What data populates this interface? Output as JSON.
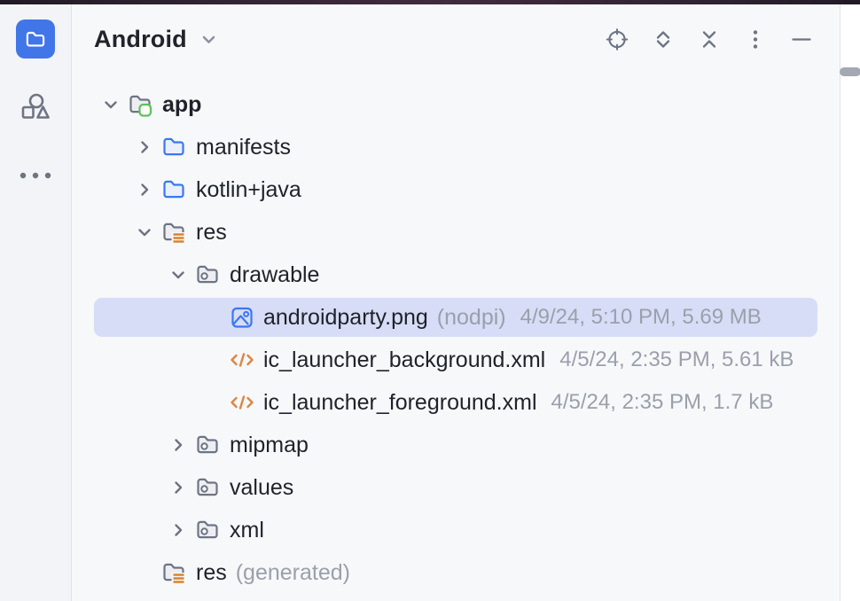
{
  "sidebar": {
    "tools": [
      {
        "name": "project",
        "selected": true
      },
      {
        "name": "resource-manager",
        "selected": false
      },
      {
        "name": "more-tool-windows",
        "selected": false
      }
    ]
  },
  "header": {
    "title": "Android",
    "actions": [
      {
        "name": "locate-file"
      },
      {
        "name": "expand-all"
      },
      {
        "name": "collapse-all"
      },
      {
        "name": "options"
      },
      {
        "name": "hide"
      }
    ]
  },
  "tree": {
    "rows": [
      {
        "label": "app",
        "icon": "module-folder",
        "chevron": "expanded",
        "depth": 0,
        "bold": true
      },
      {
        "label": "manifests",
        "icon": "blue-folder",
        "chevron": "collapsed",
        "depth": 1
      },
      {
        "label": "kotlin+java",
        "icon": "blue-folder",
        "chevron": "collapsed",
        "depth": 1
      },
      {
        "label": "res",
        "icon": "resources-folder",
        "chevron": "expanded",
        "depth": 1
      },
      {
        "label": "drawable",
        "icon": "resource-type-folder",
        "chevron": "expanded",
        "depth": 2
      },
      {
        "label": "androidparty.png",
        "suffix": "(nodpi)",
        "meta": "4/9/24, 5:10 PM, 5.69 MB",
        "icon": "image-file",
        "chevron": "none",
        "depth": 3,
        "selected": true
      },
      {
        "label": "ic_launcher_background.xml",
        "meta": "4/5/24, 2:35 PM, 5.61 kB",
        "icon": "xml-file",
        "chevron": "none",
        "depth": 3
      },
      {
        "label": "ic_launcher_foreground.xml",
        "meta": "4/5/24, 2:35 PM, 1.7 kB",
        "icon": "xml-file",
        "chevron": "none",
        "depth": 3
      },
      {
        "label": "mipmap",
        "icon": "resource-type-folder",
        "chevron": "collapsed",
        "depth": 2
      },
      {
        "label": "values",
        "icon": "resource-type-folder",
        "chevron": "collapsed",
        "depth": 2
      },
      {
        "label": "xml",
        "icon": "resource-type-folder",
        "chevron": "collapsed",
        "depth": 2
      },
      {
        "label": "res",
        "suffix": "(generated)",
        "icon": "resources-folder",
        "chevron": "none",
        "depth": 1
      }
    ]
  },
  "colors": {
    "accent_blue": "#3b77f2",
    "selection": "#d7ddf6",
    "folder_gray": "#6d7484",
    "orange": "#d9832f",
    "green": "#5fc05f",
    "muted_text": "#9aa0ab",
    "text": "#1e222a",
    "tool_button_bg": "#4176e9"
  }
}
